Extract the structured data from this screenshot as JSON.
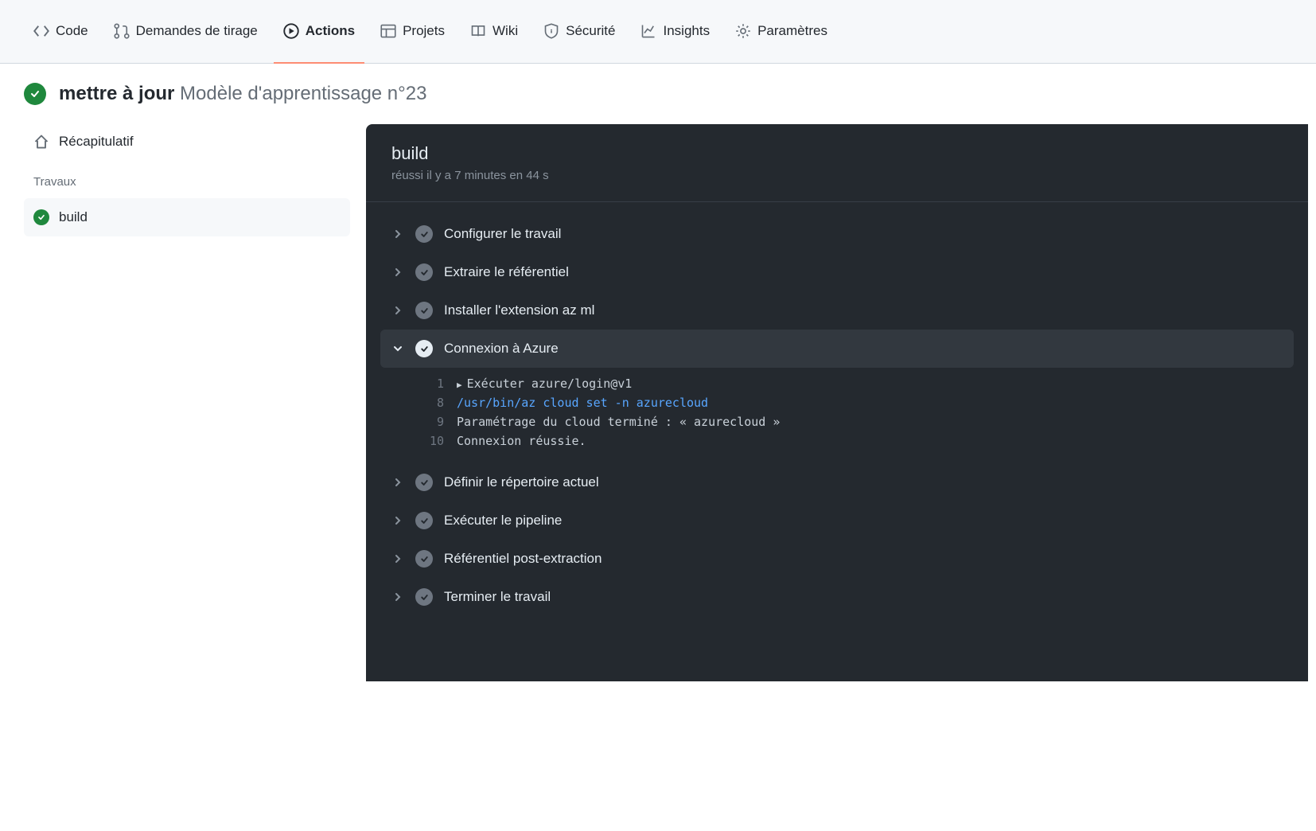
{
  "nav": {
    "code": "Code",
    "pulls": "Demandes de tirage",
    "actions": "Actions",
    "projects": "Projets",
    "wiki": "Wiki",
    "security": "Sécurité",
    "insights": "Insights",
    "settings": "Paramètres"
  },
  "title": {
    "bold": "mettre à jour",
    "rest": "Modèle d'apprentissage n°23"
  },
  "sidebar": {
    "summary": "Récapitulatif",
    "jobs_heading": "Travaux",
    "job_build": "build"
  },
  "job": {
    "name": "build",
    "status_line": "réussi il y a 7 minutes en 44 s"
  },
  "steps": [
    {
      "label": "Configurer le travail",
      "expanded": false
    },
    {
      "label": "Extraire le référentiel",
      "expanded": false
    },
    {
      "label": "Installer l'extension az ml",
      "expanded": false
    },
    {
      "label": "Connexion à Azure",
      "expanded": true
    },
    {
      "label": "Définir le répertoire actuel",
      "expanded": false
    },
    {
      "label": "Exécuter le pipeline",
      "expanded": false
    },
    {
      "label": "Référentiel post-extraction",
      "expanded": false
    },
    {
      "label": "Terminer le travail",
      "expanded": false
    }
  ],
  "log": {
    "l1_num": "1",
    "l1_text": "Exécuter azure/login@v1",
    "l8_num": "8",
    "l8_text": "/usr/bin/az cloud set -n azurecloud",
    "l9_num": "9",
    "l9_text": "Paramétrage du cloud terminé : « azurecloud »",
    "l10_num": "10",
    "l10_text": "Connexion réussie."
  }
}
